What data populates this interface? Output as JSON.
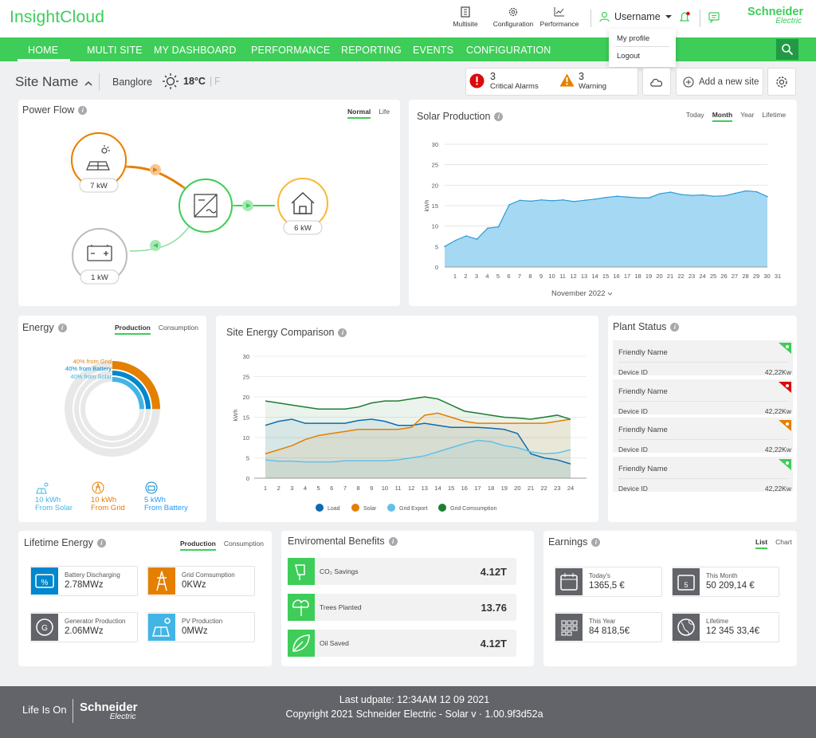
{
  "app": {
    "title": "InsightCloud"
  },
  "toolbar": {
    "multisite": "Multisite",
    "configuration": "Configuration",
    "performance": "Performance",
    "username": "Username"
  },
  "brand": {
    "name": "Schneider",
    "sub": "Electric"
  },
  "user_menu": {
    "profile": "My profile",
    "logout": "Logout"
  },
  "nav": {
    "items": [
      "HOME",
      "MULTI SITE",
      "MY DASHBOARD",
      "PERFORMANCE",
      "REPORTING",
      "EVENTS",
      "CONFIGURATION"
    ],
    "active": "HOME"
  },
  "site": {
    "name": "Site Name",
    "location": "Banglore",
    "temp": "18°C",
    "unit_sep": "|",
    "unit_alt": "F"
  },
  "alerts": {
    "critical": {
      "count": "3",
      "label": "Critical Alarms"
    },
    "warning": {
      "count": "3",
      "label": "Warning"
    }
  },
  "actions": {
    "add_site": "Add a new site"
  },
  "power_flow": {
    "title": "Power Flow",
    "tabs": [
      "Normal",
      "Life"
    ],
    "solar": "7 kW",
    "battery": "1 kW",
    "home": "6 kW"
  },
  "solar_production": {
    "title": "Solar Production",
    "tabs": [
      "Today",
      "Month",
      "Year",
      "Lifetime"
    ],
    "active_tab": "Month",
    "period": "November 2022"
  },
  "energy": {
    "title": "Energy",
    "tabs": [
      "Production",
      "Consumption"
    ],
    "grid_label": "40% from Grid",
    "battery_label": "40% from Battery",
    "solar_label": "40% from Solar",
    "grid_pct": 40,
    "battery_pct": 40,
    "solar_pct": 40,
    "sources": [
      {
        "value": "10 kWh",
        "label": "From Solar",
        "color": "#42b4e6"
      },
      {
        "value": "10 kWh",
        "label": "From Grid",
        "color": "#e47f00"
      },
      {
        "value": "5 kWh",
        "label": "From Battery",
        "color": "#219bfd"
      }
    ]
  },
  "site_energy": {
    "title": "Site Energy Comparison"
  },
  "plant_status": {
    "title": "Plant Status",
    "rows": [
      {
        "name": "Friendly Name",
        "id_label": "Device ID",
        "value": "42,22Kw",
        "flag": "#3dcd58"
      },
      {
        "name": "Friendly Name",
        "id_label": "Device ID",
        "value": "42,22Kw",
        "flag": "#dc0a0a"
      },
      {
        "name": "Friendly Name",
        "id_label": "Device ID",
        "value": "42,22Kw",
        "flag": "#e47f00"
      },
      {
        "name": "Friendly Name",
        "id_label": "Device ID",
        "value": "42,22Kw",
        "flag": "#3dcd58"
      }
    ]
  },
  "lifetime_energy": {
    "title": "Lifetime Energy",
    "tabs": [
      "Production",
      "Consumption"
    ],
    "tiles": [
      {
        "label": "Battery Discharging",
        "value": "2.78MWz",
        "color": "#0087cd",
        "icon": "battery-percent-icon"
      },
      {
        "label": "Grid Comsumption",
        "value": "0KWz",
        "color": "#e47f00",
        "icon": "grid-tower-icon"
      },
      {
        "label": "Generator Production",
        "value": "2.06MWz",
        "color": "#626469",
        "icon": "generator-icon"
      },
      {
        "label": "PV Production",
        "value": "0MWz",
        "color": "#42b4e6",
        "icon": "solar-panel-icon"
      }
    ]
  },
  "environmental": {
    "title": "Enviromental Benefits",
    "rows": [
      {
        "label": "CO₂ Savings",
        "value": "4.12T",
        "icon": "co2-icon"
      },
      {
        "label": "Trees Planted",
        "value": "13.76",
        "icon": "tree-icon"
      },
      {
        "label": "Oil Saved",
        "value": "4.12T",
        "icon": "leaf-icon"
      }
    ]
  },
  "earnings": {
    "title": "Earnings",
    "tabs": [
      "List",
      "Chart"
    ],
    "tiles": [
      {
        "label": "Today's",
        "value": "1365,5  €",
        "icon": "calendar-icon"
      },
      {
        "label": "This Month",
        "value": "50 209,14 €",
        "icon": "calendar-5-icon"
      },
      {
        "label": "This Year",
        "value": "84 818,5€",
        "icon": "grid-calendar-icon"
      },
      {
        "label": "Lifetime",
        "value": "12 345 33,4€",
        "icon": "globe-icon"
      }
    ]
  },
  "footer": {
    "tagline": "Life Is On",
    "brand": "Schneider",
    "brand_sub": "Electric",
    "last_update": "Last udpate: 12:34AM 12 09 2021",
    "copyright": "Copyright 2021 Schneider Electric - Solar v · 1.00.9f3d52a"
  },
  "chart_data": [
    {
      "type": "area",
      "title": "Solar Production",
      "ylabel": "kWh",
      "xlabel": "November 2022",
      "ylim": [
        0,
        30
      ],
      "yticks": [
        0,
        5,
        10,
        15,
        20,
        25,
        30
      ],
      "x": [
        1,
        2,
        3,
        4,
        5,
        6,
        7,
        8,
        9,
        10,
        11,
        12,
        13,
        14,
        15,
        16,
        17,
        18,
        19,
        20,
        21,
        22,
        23,
        24,
        25,
        26,
        27,
        28,
        29,
        30,
        31
      ],
      "series": [
        {
          "values": [
            5,
            6.5,
            7.6,
            6.8,
            9.5,
            9.8,
            15.2,
            16.3,
            16.1,
            16.4,
            16.2,
            16.4,
            16.0,
            16.3,
            16.6,
            17.0,
            17.3,
            17.1,
            16.9,
            16.9,
            17.9,
            18.3,
            17.7,
            17.5,
            17.6,
            17.3,
            17.4,
            18.0,
            18.6,
            18.4,
            17.2
          ]
        }
      ],
      "grid": true,
      "color": "#a5d8f3"
    },
    {
      "type": "line",
      "title": "Site Energy Comparison",
      "ylabel": "kWh",
      "ylim": [
        0,
        30
      ],
      "yticks": [
        0,
        5,
        10,
        15,
        20,
        25,
        30
      ],
      "x": [
        1,
        2,
        3,
        4,
        5,
        6,
        7,
        8,
        9,
        10,
        11,
        12,
        13,
        14,
        15,
        16,
        17,
        18,
        19,
        20,
        21,
        22,
        23,
        24
      ],
      "series": [
        {
          "name": "Load",
          "color": "#0e6bad",
          "values": [
            13,
            14,
            14.5,
            13.5,
            13.5,
            13.5,
            13.5,
            14.2,
            14.5,
            14,
            13,
            13,
            13.5,
            13,
            12.5,
            12.5,
            12.5,
            12.3,
            12,
            11,
            6,
            5,
            4.5,
            3.5
          ]
        },
        {
          "name": "Solar",
          "color": "#e47f00",
          "values": [
            6,
            7,
            8,
            9.5,
            10.5,
            11,
            11.5,
            12,
            12,
            12,
            12,
            12.5,
            15.5,
            16,
            15,
            14,
            13.5,
            13.5,
            13.5,
            13.5,
            13.5,
            13.5,
            14,
            14.5
          ]
        },
        {
          "name": "Grid Export",
          "color": "#62c0e8",
          "values": [
            4.5,
            4.2,
            4.2,
            4,
            4,
            4,
            4.3,
            4.3,
            4.3,
            4.3,
            4.5,
            5,
            5.5,
            6.5,
            7.5,
            8.5,
            9.3,
            9,
            8,
            7.5,
            6.5,
            6,
            6.2,
            7
          ]
        },
        {
          "name": "Grid Comsumption",
          "color": "#1e7d32",
          "values": [
            19,
            18.5,
            18,
            17.5,
            17,
            17,
            17,
            17.5,
            18.5,
            19,
            19,
            19.5,
            20,
            19.5,
            18,
            16.5,
            16,
            15.5,
            15,
            14.8,
            14.5,
            15,
            15.5,
            14.5
          ]
        }
      ],
      "legend": "bottom",
      "grid": true
    }
  ]
}
